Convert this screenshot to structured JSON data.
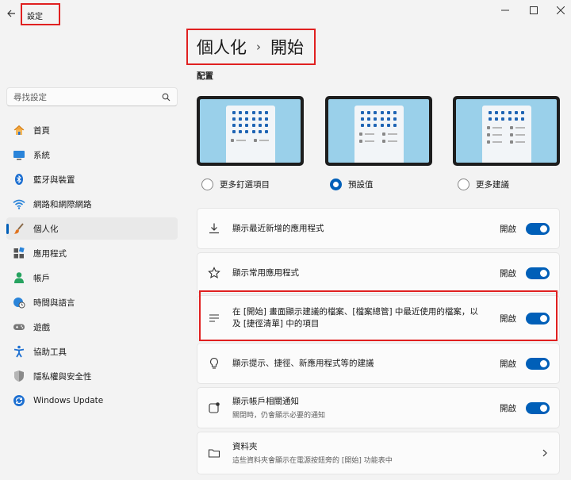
{
  "window": {
    "title": "設定"
  },
  "search": {
    "placeholder": "尋找設定"
  },
  "sidebar": {
    "items": [
      {
        "label": "首頁",
        "icon": "home-icon"
      },
      {
        "label": "系統",
        "icon": "monitor-icon"
      },
      {
        "label": "藍牙與裝置",
        "icon": "bluetooth-icon"
      },
      {
        "label": "網路和網際網路",
        "icon": "wifi-icon"
      },
      {
        "label": "個人化",
        "icon": "brush-icon",
        "active": true
      },
      {
        "label": "應用程式",
        "icon": "apps-icon"
      },
      {
        "label": "帳戶",
        "icon": "person-icon"
      },
      {
        "label": "時間與語言",
        "icon": "globe-clock-icon"
      },
      {
        "label": "遊戲",
        "icon": "gamepad-icon"
      },
      {
        "label": "協助工具",
        "icon": "accessibility-icon"
      },
      {
        "label": "隱私權與安全性",
        "icon": "shield-icon"
      },
      {
        "label": "Windows Update",
        "icon": "update-icon"
      }
    ]
  },
  "header": {
    "parent": "個人化",
    "separator": "›",
    "current": "開始"
  },
  "layout": {
    "label": "配置",
    "options": [
      {
        "label": "更多釘選項目",
        "selected": false
      },
      {
        "label": "預設值",
        "selected": true
      },
      {
        "label": "更多建議",
        "selected": false
      }
    ]
  },
  "settings": [
    {
      "title": "顯示最近新增的應用程式",
      "state": "開啟",
      "icon": "download-icon"
    },
    {
      "title": "顯示常用應用程式",
      "state": "開啟",
      "icon": "star-icon"
    },
    {
      "title": "在 [開始] 畫面顯示建議的檔案、[檔案總管] 中最近使用的檔案，以及 [捷徑清單] 中的項目",
      "state": "開啟",
      "icon": "list-icon"
    },
    {
      "title": "顯示提示、捷徑、新應用程式等的建議",
      "state": "開啟",
      "icon": "lightbulb-icon"
    },
    {
      "title": "顯示帳戶相關通知",
      "subtitle": "關閉時，仍會顯示必要的通知",
      "state": "開啟",
      "icon": "notification-icon"
    },
    {
      "title": "資料夾",
      "subtitle": "這些資料夾會顯示在電源按鈕旁的 [開始] 功能表中",
      "icon": "folder-icon"
    }
  ],
  "colors": {
    "accent": "#005fb8",
    "highlight": "#e02020",
    "background": "#f3f3f3"
  }
}
